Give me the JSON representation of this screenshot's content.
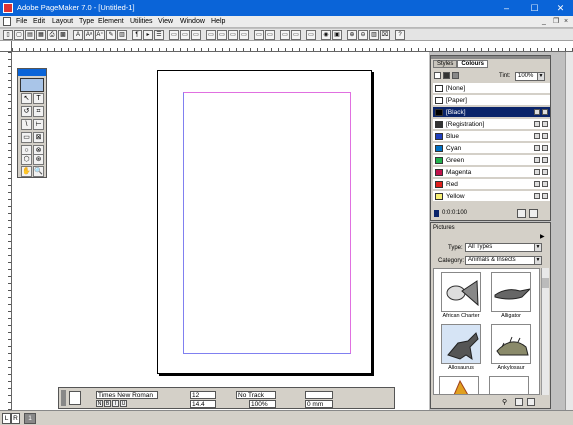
{
  "window": {
    "title": "Adobe PageMaker 7.0 - [Untitled-1]",
    "minimize": "–",
    "maximize": "☐",
    "close": "✕",
    "mdi_minimize": "_",
    "mdi_restore": "❐",
    "mdi_close": "×"
  },
  "menu": [
    "File",
    "Edit",
    "Layout",
    "Type",
    "Element",
    "Utilities",
    "View",
    "Window",
    "Help"
  ],
  "toolbar": {
    "buttons": [
      "▯",
      "▢",
      "▤",
      "▦",
      "⎙",
      "▩",
      "A",
      "Aᵃ",
      "A⁺",
      "✎",
      "▥",
      "¶",
      "▸",
      "☰",
      "▭",
      "▭",
      "▭",
      "▭",
      "▭",
      "▭",
      "▭",
      "▭",
      "▭",
      "▭",
      "▭",
      "▭",
      "◉",
      "▣",
      "⊕",
      "⊖",
      "▥",
      "⌧",
      "?"
    ]
  },
  "ruler": {
    "v_labels": [
      "0",
      "1",
      "2",
      "3",
      "4",
      "5",
      "6",
      "7",
      "8",
      "9",
      "10",
      "11",
      "12",
      "13",
      "14",
      "15",
      "16",
      "17",
      "18",
      "19",
      "20",
      "21",
      "22",
      "23"
    ]
  },
  "toolbox": {
    "tools": [
      "↖",
      "T",
      "↺",
      "⌗",
      "\\",
      "⊢",
      "▭",
      "⊠",
      "○",
      "⊗",
      "⬡",
      "⊛",
      "✋",
      "🔍"
    ]
  },
  "colors_panel": {
    "tabs": [
      "Styles",
      "Colours"
    ],
    "tint_label": "Tint:",
    "tint_value": "100%",
    "rows": [
      {
        "name": "[None]",
        "color": "#ffffff",
        "selected": false
      },
      {
        "name": "[Paper]",
        "color": "#ffffff",
        "selected": false
      },
      {
        "name": "[Black]",
        "color": "#000000",
        "selected": true
      },
      {
        "name": "[Registration]",
        "color": "#333333",
        "selected": false
      },
      {
        "name": "Blue",
        "color": "#1f3fbf",
        "selected": false
      },
      {
        "name": "Cyan",
        "color": "#0072c6",
        "selected": false
      },
      {
        "name": "Green",
        "color": "#22b14c",
        "selected": false
      },
      {
        "name": "Magenta",
        "color": "#c1124b",
        "selected": false
      },
      {
        "name": "Red",
        "color": "#e0201c",
        "selected": false
      },
      {
        "name": "Yellow",
        "color": "#f8f072",
        "selected": false
      }
    ],
    "cmyk_readout": "0:0:0:100"
  },
  "pictures_panel": {
    "title": "Pictures",
    "type_label": "Type:",
    "type_value": "All Types",
    "category_label": "Category:",
    "category_value": "Animals & Insects",
    "items": [
      {
        "label": "African Charter"
      },
      {
        "label": "Alligator"
      },
      {
        "label": "Allosaurus"
      },
      {
        "label": "Ankylosaur"
      }
    ]
  },
  "control_palette": {
    "font": "Times New Roman",
    "size": "12",
    "leading": "14.4",
    "track": "No Track",
    "width": "100%",
    "indent": "0 mm"
  },
  "status": {
    "pages": [
      "L",
      "R"
    ],
    "page_number": "1"
  }
}
